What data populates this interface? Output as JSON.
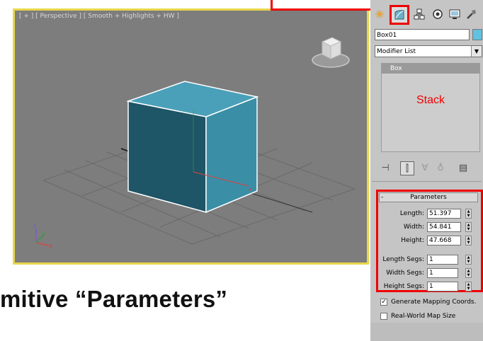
{
  "viewport": {
    "label": "[ + ] [ Perspective ] [ Smooth + Highlights + HW ]",
    "axis_x": "x",
    "axis_y": "y",
    "axis_z": "z"
  },
  "caption": "mitive “Parameters”",
  "panel": {
    "tabs": [
      "create-icon",
      "modify-icon",
      "hierarchy-icon",
      "motion-icon",
      "display-icon",
      "utilities-icon"
    ],
    "object_name": "Box01",
    "object_color": "#5fc2e0",
    "modifier_list": "Modifier List",
    "stack_item": "Box",
    "stack_annotation": "Stack",
    "parameters": {
      "title": "Parameters",
      "length_label": "Length:",
      "length": "51.397",
      "width_label": "Width:",
      "width": "54.841",
      "height_label": "Height:",
      "height": "47.668",
      "length_segs_label": "Length Segs:",
      "length_segs": "1",
      "width_segs_label": "Width Segs:",
      "width_segs": "1",
      "height_segs_label": "Height Segs:",
      "height_segs": "1"
    },
    "generate_mapping": {
      "label": "Generate Mapping Coords.",
      "checked": true
    },
    "real_world": {
      "label": "Real-World Map Size",
      "checked": false
    }
  },
  "colors": {
    "highlight": "#e00000",
    "viewport_border": "#e9d64a",
    "box_front": "#1e5567",
    "box_side": "#3a8ea6",
    "box_top": "#4aa0b8"
  }
}
